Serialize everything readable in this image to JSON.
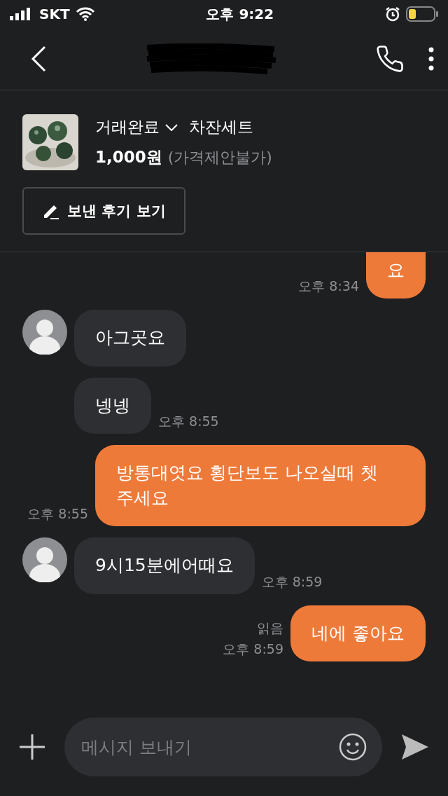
{
  "status_bar": {
    "carrier": "SKT",
    "time": "오후 9:22"
  },
  "product": {
    "status": "거래완료",
    "name": "차잔세트",
    "price": "1,000원",
    "price_note": "(가격제안불가)",
    "review_button": "보낸 후기 보기"
  },
  "messages": [
    {
      "kind": "sent",
      "text": "요",
      "time": "오후 8:34",
      "clipped": true
    },
    {
      "kind": "received",
      "text": "아그곳요",
      "avatar": true
    },
    {
      "kind": "received",
      "text": "넹넹",
      "avatar": false,
      "time": "오후 8:55"
    },
    {
      "kind": "sent",
      "text": "방통대엿요 횡단보도 나오실때 쳇 주세요",
      "time": "오후 8:55",
      "clipped": false
    },
    {
      "kind": "received",
      "text": "9시15분에어때요",
      "avatar": true,
      "time": "오후 8:59"
    },
    {
      "kind": "sent",
      "text": "네에 좋아요",
      "read": "읽음",
      "time": "오후 8:59",
      "clipped": false
    }
  ],
  "composer": {
    "placeholder": "메시지 보내기"
  }
}
